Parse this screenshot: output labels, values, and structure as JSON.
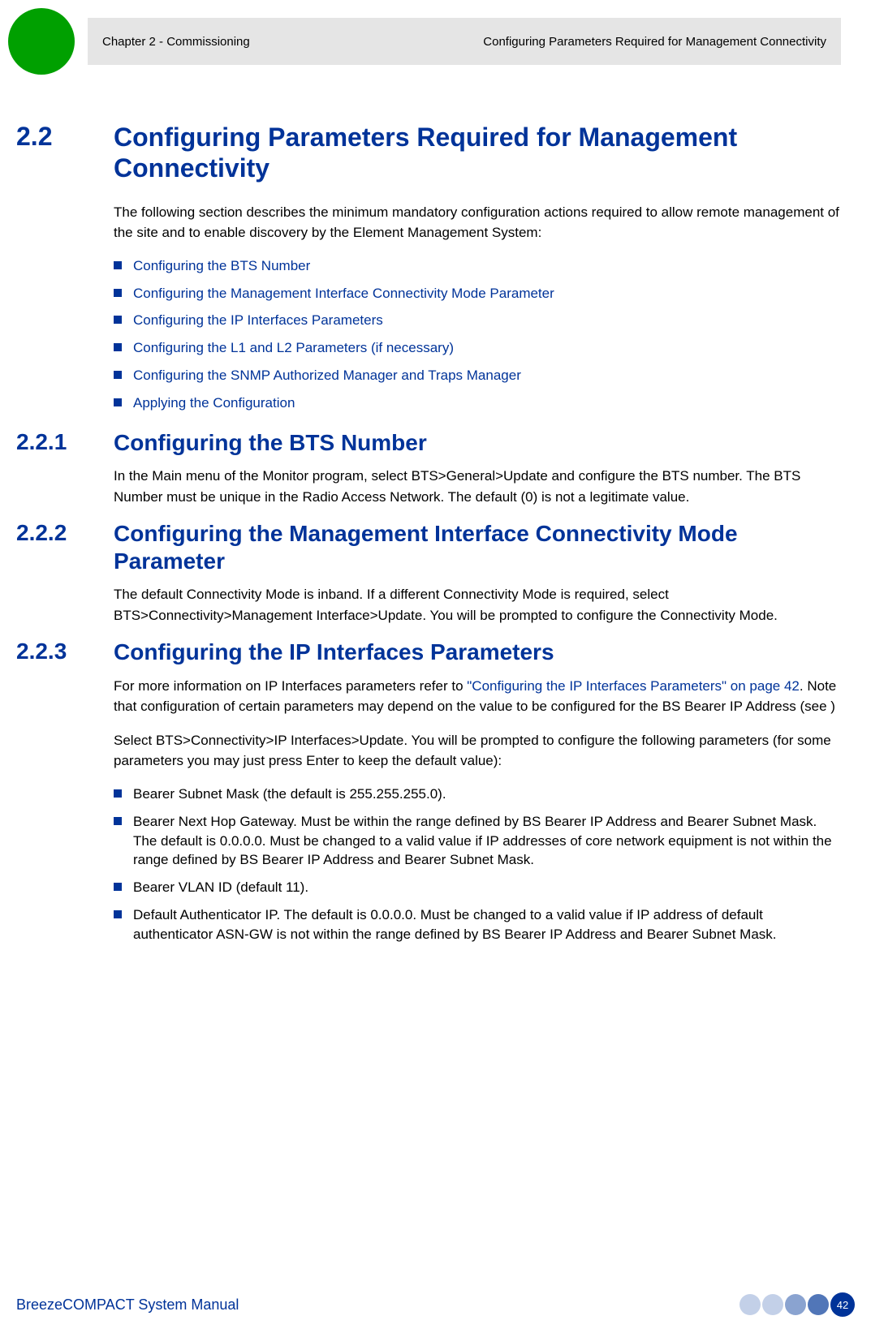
{
  "header": {
    "chapter": "Chapter 2 - Commissioning",
    "section": "Configuring Parameters Required for Management Connectivity"
  },
  "s22": {
    "num": "2.2",
    "title": "Configuring Parameters Required for Management Connectivity",
    "intro": "The following section describes the minimum mandatory configuration actions required to allow remote management of the site and to enable discovery by the Element Management System:",
    "links": [
      "Configuring the BTS Number",
      "Configuring the Management Interface Connectivity Mode Parameter",
      "Configuring the IP Interfaces Parameters",
      "Configuring the L1 and L2 Parameters (if necessary)",
      "Configuring the SNMP Authorized Manager and Traps Manager",
      "Applying the Configuration"
    ]
  },
  "s221": {
    "num": "2.2.1",
    "title": "Configuring the BTS Number",
    "body": "In the Main menu of the Monitor program, select BTS>General>Update and configure the BTS number. The BTS Number must be unique in the Radio Access Network. The default (0) is not a legitimate value."
  },
  "s222": {
    "num": "2.2.2",
    "title": "Configuring the Management Interface Connectivity Mode Parameter",
    "body": "The default Connectivity Mode is inband. If a different Connectivity Mode is required, select BTS>Connectivity>Management Interface>Update. You will be prompted to configure the Connectivity Mode."
  },
  "s223": {
    "num": "2.2.3",
    "title": "Configuring the IP Interfaces Parameters",
    "p1_a": "For more information on IP Interfaces parameters refer to ",
    "p1_link": "\"Configuring the IP Interfaces Parameters\" on page 42",
    "p1_b": ". Note that configuration of certain parameters may depend on the value to be configured for the BS Bearer IP Address (see )",
    "p2": "Select BTS>Connectivity>IP Interfaces>Update. You will be prompted to configure the following parameters (for some parameters you may just press Enter to keep the default value):",
    "items": [
      "Bearer Subnet Mask (the default is 255.255.255.0).",
      "Bearer Next Hop Gateway. Must be within the range defined by BS Bearer IP Address and Bearer Subnet Mask. The default is 0.0.0.0. Must be changed to a valid value if IP addresses of core network equipment is not within the range defined by BS Bearer IP Address and Bearer Subnet Mask.",
      "Bearer VLAN ID (default 11).",
      "Default Authenticator IP. The default is 0.0.0.0. Must be changed to a valid value if IP address of default authenticator ASN-GW is not within the range defined by BS Bearer IP Address and Bearer Subnet Mask."
    ]
  },
  "footer": {
    "title": "BreezeCOMPACT System Manual",
    "page": "42"
  }
}
